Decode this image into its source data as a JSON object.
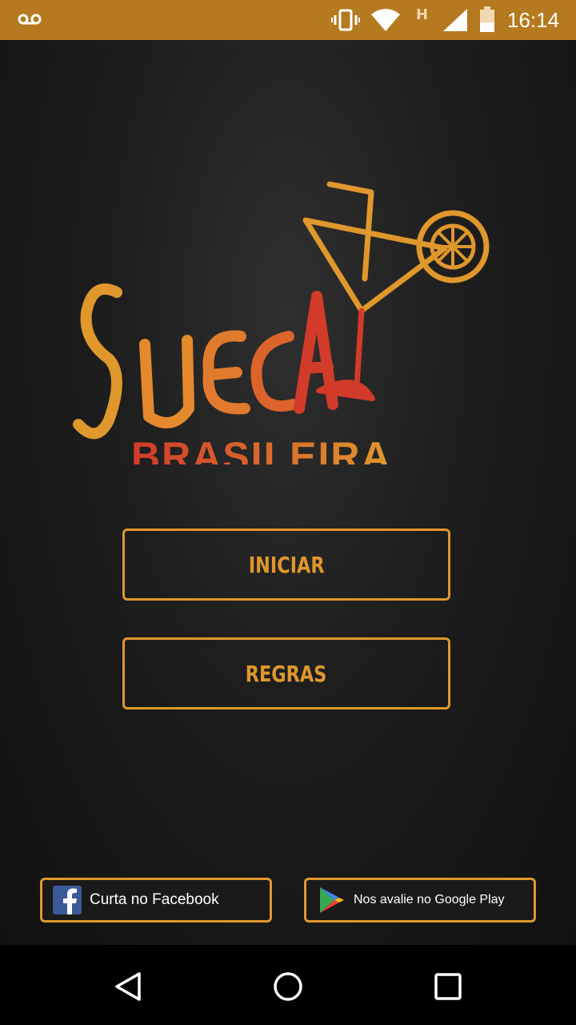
{
  "status_bar": {
    "time": "16:14",
    "network_label": "H",
    "icons": [
      "voicemail-icon",
      "vibrate-icon",
      "wifi-icon",
      "signal-icon",
      "battery-icon"
    ]
  },
  "logo": {
    "title": "SUECA",
    "subtitle": "BRASILEIRA",
    "colors": {
      "orange": "#e0972c",
      "red": "#d23a2a"
    }
  },
  "menu": {
    "start_label": "INICIAR",
    "rules_label": "REGRAS"
  },
  "social": {
    "facebook_label": "Curta no Facebook",
    "google_play_label": "Nos avalie no Google Play"
  },
  "nav_bar": {
    "icons": [
      "back-icon",
      "home-icon",
      "recent-apps-icon"
    ]
  },
  "theme": {
    "accent": "#e0972c",
    "status_bar_bg": "#b57a1f",
    "background": "#1d1d1d"
  }
}
